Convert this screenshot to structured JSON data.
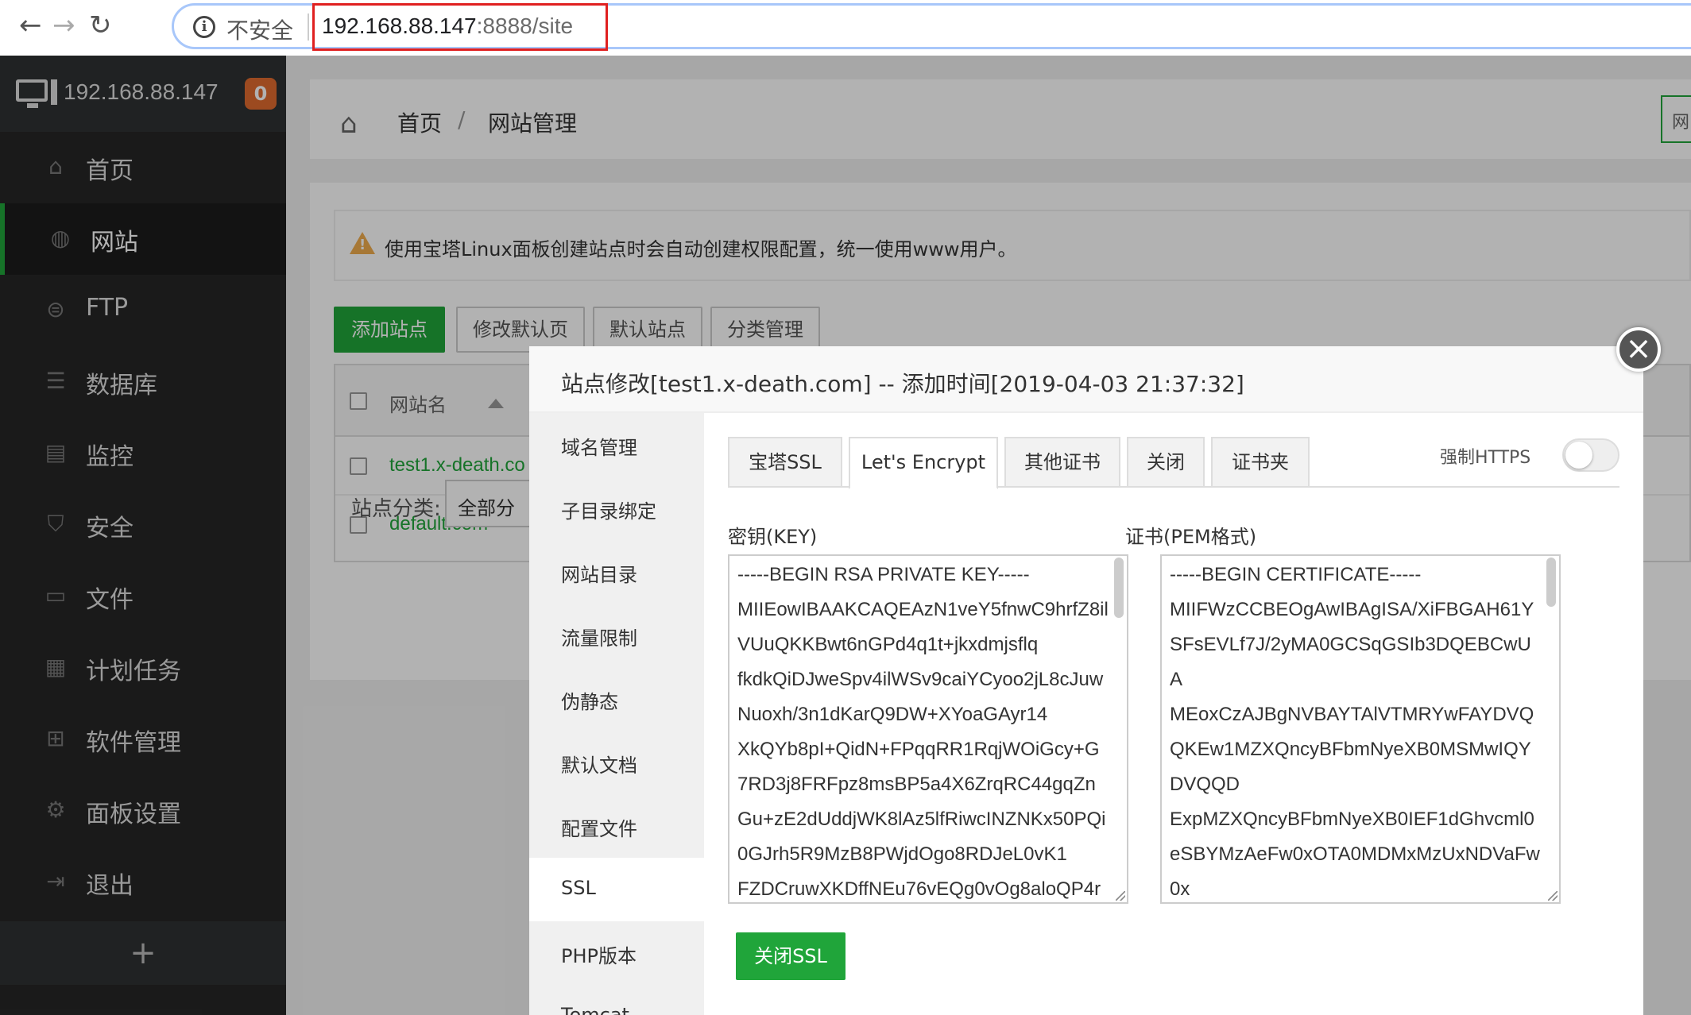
{
  "browser": {
    "insecure_label": "不安全",
    "url_host": "192.168.88.147",
    "url_path": ":8888/site"
  },
  "sidebar": {
    "ip": "192.168.88.147",
    "badge": "0",
    "items": [
      {
        "label": "首页",
        "icon": "home-icon"
      },
      {
        "label": "网站",
        "icon": "globe-icon"
      },
      {
        "label": "FTP",
        "icon": "ftp-icon"
      },
      {
        "label": "数据库",
        "icon": "database-icon"
      },
      {
        "label": "监控",
        "icon": "monitor-chart-icon"
      },
      {
        "label": "安全",
        "icon": "shield-icon"
      },
      {
        "label": "文件",
        "icon": "folder-icon"
      },
      {
        "label": "计划任务",
        "icon": "calendar-icon"
      },
      {
        "label": "软件管理",
        "icon": "apps-icon"
      },
      {
        "label": "面板设置",
        "icon": "gear-icon"
      },
      {
        "label": "退出",
        "icon": "logout-icon"
      }
    ],
    "plus": "+"
  },
  "breadcrumb": {
    "home": "首页",
    "sep": "/",
    "current": "网站管理",
    "right_fragment": "网"
  },
  "alert": {
    "text": "使用宝塔Linux面板创建站点时会自动创建权限配置，统一使用www用户。"
  },
  "toolbar": {
    "add_site": "添加站点",
    "edit_default_page": "修改默认页",
    "default_site": "默认站点",
    "category_manage": "分类管理"
  },
  "table": {
    "header_name": "网站名",
    "rows": [
      "test1.x-death.co",
      "default.com"
    ]
  },
  "category": {
    "label": "站点分类:",
    "value": "全部分"
  },
  "modal": {
    "title": "站点修改[test1.x-death.com] -- 添加时间[2019-04-03 21:37:32]",
    "close": "×",
    "nav": [
      "域名管理",
      "子目录绑定",
      "网站目录",
      "流量限制",
      "伪静态",
      "默认文档",
      "配置文件",
      "SSL",
      "PHP版本",
      "Tomcat"
    ],
    "tabs": [
      "宝塔SSL",
      "Let's Encrypt",
      "其他证书",
      "关闭",
      "证书夹"
    ],
    "force_https_label": "强制HTTPS",
    "force_https_on": false,
    "key_label": "密钥(KEY)",
    "cert_label": "证书(PEM格式)",
    "key_lines": [
      "-----BEGIN RSA PRIVATE KEY-----",
      "MIIEowIBAAKCAQEAzN1veY5fnwC9hrfZ8il",
      "VUuQKKBwt6nGPd4q1t+jkxdmjsflq",
      "fkdkQiDJweSpv4ilWSv9caiYCyoo2jL8cJuw",
      "Nuoxh/3n1dKarQ9DW+XYoaGAyr14",
      "XkQYb8pI+QidN+FPqqRR1RqjWOiGcy+G",
      "7RD3j8FRFpz8msBP5a4X6ZrqRC44gqZn",
      "Gu+zE2dUddjWK8lAz5lfRiwcINZNKx50PQi",
      "0GJrh5R9MzB8PWjdOgo8RDJeL0vK1",
      "FZDCruwXKDffNEu76vEQg0vOg8aloQP4r"
    ],
    "cert_lines": [
      "-----BEGIN CERTIFICATE-----",
      "MIIFWzCCBEOgAwIBAgISA/XiFBGAH61Y",
      "SFsEVLf7J/2yMA0GCSqGSIb3DQEBCwU",
      "A",
      "MEoxCzAJBgNVBAYTAlVTMRYwFAYDVQ",
      "QKEw1MZXQncyBFbmNyeXB0MSMwIQY",
      "DVQQD",
      "ExpMZXQncyBFbmNyeXB0IEF1dGhvcml0",
      "eSBYMzAeFw0xOTA0MDMxMzUxNDVaFw",
      "0x"
    ],
    "close_ssl": "关闭SSL"
  },
  "colors": {
    "accent": "#20a53a",
    "badge": "#e06b2f",
    "sidebar": "#262626"
  }
}
